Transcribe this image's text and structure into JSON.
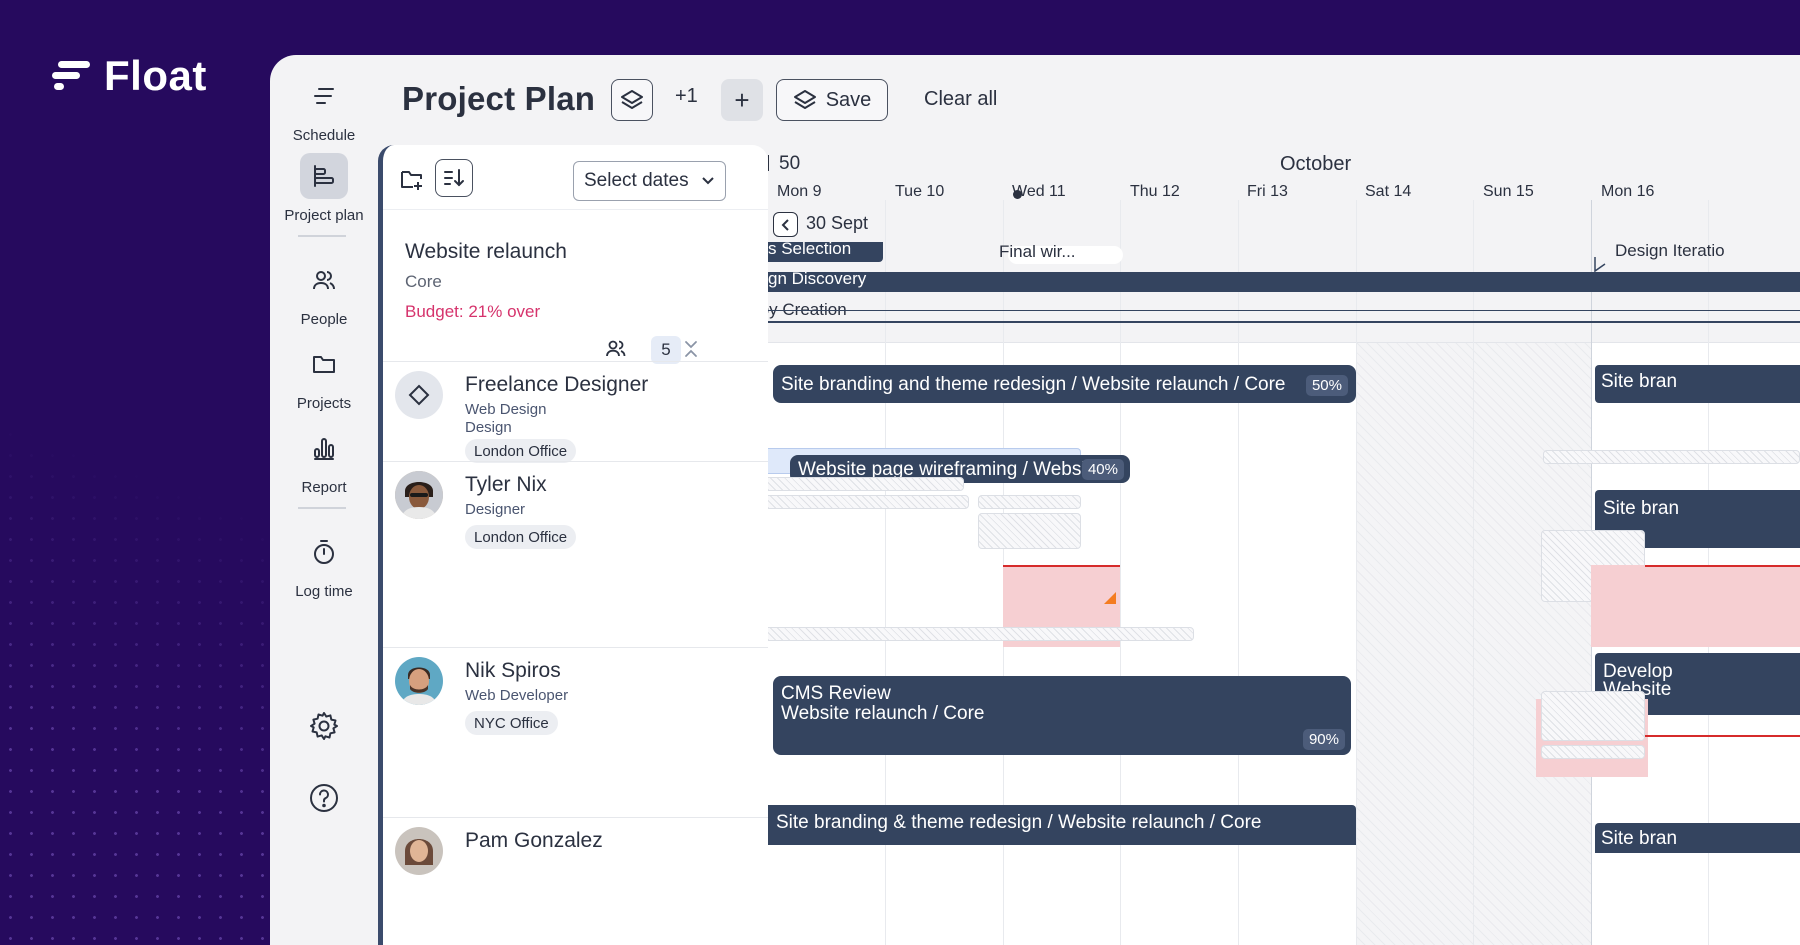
{
  "brand": {
    "name": "Float"
  },
  "nav": {
    "items": [
      {
        "label": "Schedule",
        "icon": "schedule-icon"
      },
      {
        "label": "Project plan",
        "icon": "project-plan-icon",
        "active": true
      },
      {
        "label": "People",
        "icon": "people-icon"
      },
      {
        "label": "Projects",
        "icon": "folder-icon"
      },
      {
        "label": "Report",
        "icon": "bar-chart-icon"
      },
      {
        "label": "Log time",
        "icon": "stopwatch-icon"
      }
    ],
    "settings_icon": "gear-icon",
    "help_icon": "help-icon"
  },
  "header": {
    "title": "Project Plan",
    "plus_one": "+1",
    "add_label": "+",
    "save_label": "Save",
    "clear_label": "Clear all"
  },
  "panel": {
    "select_dates": "Select dates",
    "project": {
      "name": "Website relaunch",
      "client": "Core",
      "budget": "Budget: 21% over",
      "people_count": "5"
    },
    "people": [
      {
        "name": "Freelance Designer",
        "role": "Web Design",
        "role2": "Design",
        "office": "London Office"
      },
      {
        "name": "Tyler Nix",
        "role": "Designer",
        "office": "London Office"
      },
      {
        "name": "Nik Spiros",
        "role": "Web Developer",
        "office": "NYC Office"
      },
      {
        "name": "Pam Gonzalez"
      }
    ]
  },
  "timeline": {
    "week": "50",
    "month": "October",
    "days": [
      "Mon 9",
      "Tue 10",
      "Wed 11",
      "Thu 12",
      "Fri 13",
      "Sat 14",
      "Sun 15",
      "Mon 16"
    ],
    "back_label": "30 Sept",
    "milestones": [
      "s Selection",
      "gn Discovery",
      "Copy Creation",
      "Final wir...",
      "Design Iteratio"
    ],
    "tasks": [
      {
        "label": "Site branding and theme redesign / Website relaunch / Core",
        "pct": "50%"
      },
      {
        "label": "Site bran"
      },
      {
        "label": "Website page wireframing / Websi",
        "pct": "40%"
      },
      {
        "label": "Site bran"
      },
      {
        "label": "CMS Review",
        "label2": "Website relaunch / Core",
        "pct": "90%"
      },
      {
        "label": "Develop",
        "label2": "Website"
      },
      {
        "label": "Site branding & theme redesign / Website relaunch / Core"
      },
      {
        "label": "Site bran"
      }
    ]
  },
  "colors": {
    "background": "#260a5e",
    "task": "#34445f",
    "budget": "#d6336c",
    "overlap": "#d62b2b"
  }
}
